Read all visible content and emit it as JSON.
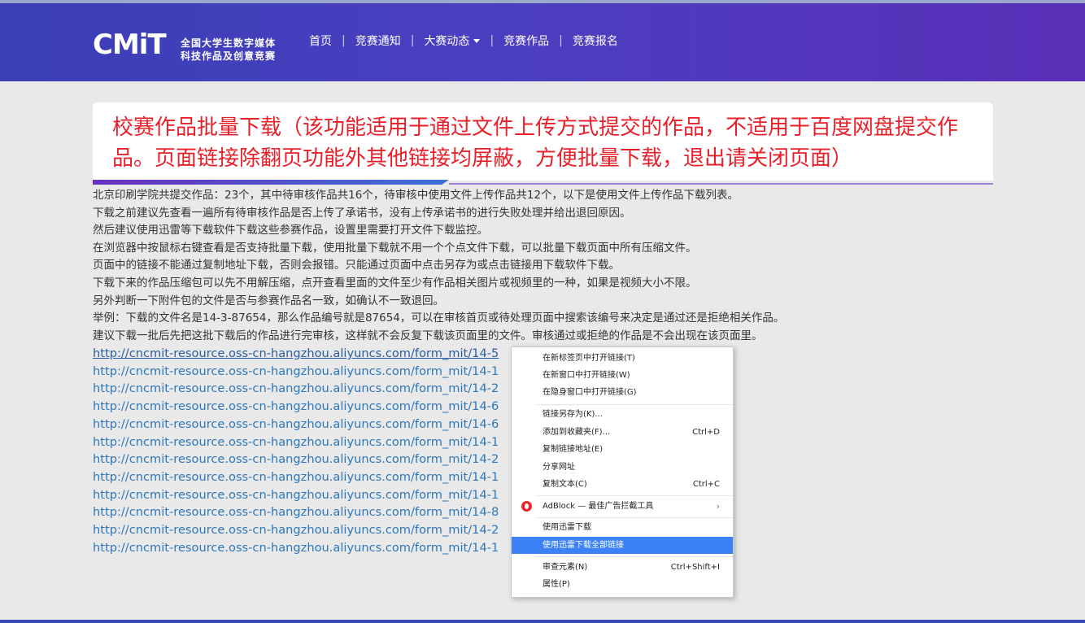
{
  "header": {
    "logo": {
      "mark": "CMiT",
      "line1": "全国大学生数字媒体",
      "line2": "科技作品及创意竞赛"
    },
    "nav": [
      {
        "label": "首页"
      },
      {
        "label": "竞赛通知"
      },
      {
        "label": "大赛动态",
        "has_dropdown": true
      },
      {
        "label": "竞赛作品"
      },
      {
        "label": "竞赛报名"
      }
    ],
    "nav_separator": "|"
  },
  "page": {
    "title": "校赛作品批量下载（该功能适用于通过文件上传方式提交的作品，不适用于百度网盘提交作品。页面链接除翻页功能外其他链接均屏蔽，方便批量下载，退出请关闭页面）",
    "info_lines": [
      "北京印刷学院共提交作品：23个，其中待审核作品共16个，待审核中使用文件上传作品共12个，以下是使用文件上传作品下载列表。",
      "下载之前建议先查看一遍所有待审核作品是否上传了承诺书，没有上传承诺书的进行失败处理并给出退回原因。",
      "然后建议使用迅雷等下载软件下载这些参赛作品，设置里需要打开文件下载监控。",
      "在浏览器中按鼠标右键查看是否支持批量下载，使用批量下载就不用一个个点文件下载，可以批量下载页面中所有压缩文件。",
      "页面中的链接不能通过复制地址下载，否则会报错。只能通过页面中点击另存为或点击链接用下载软件下载。",
      "下载下来的作品压缩包可以先不用解压缩，点开查看里面的文件至少有作品相关图片或视频里的一种，如果是视频大小不限。",
      "另外判断一下附件包的文件是否与参赛作品名一致，如确认不一致退回。",
      "举例：下载的文件名是14-3-87654，那么作品编号就是87654，可以在审核首页或待处理页面中搜索该编号来决定是通过还是拒绝相关作品。",
      "建议下载一批后先把这批下载后的作品进行完审核，这样就不会反复下载该页面里的文件。审核通过或拒绝的作品是不会出现在该页面里。"
    ],
    "links": [
      "http://cncmit-resource.oss-cn-hangzhou.aliyuncs.com/form_mit/14-5",
      "http://cncmit-resource.oss-cn-hangzhou.aliyuncs.com/form_mit/14-1",
      "http://cncmit-resource.oss-cn-hangzhou.aliyuncs.com/form_mit/14-2",
      "http://cncmit-resource.oss-cn-hangzhou.aliyuncs.com/form_mit/14-6",
      "http://cncmit-resource.oss-cn-hangzhou.aliyuncs.com/form_mit/14-6",
      "http://cncmit-resource.oss-cn-hangzhou.aliyuncs.com/form_mit/14-1",
      "http://cncmit-resource.oss-cn-hangzhou.aliyuncs.com/form_mit/14-2",
      "http://cncmit-resource.oss-cn-hangzhou.aliyuncs.com/form_mit/14-1",
      "http://cncmit-resource.oss-cn-hangzhou.aliyuncs.com/form_mit/14-1",
      "http://cncmit-resource.oss-cn-hangzhou.aliyuncs.com/form_mit/14-8",
      "http://cncmit-resource.oss-cn-hangzhou.aliyuncs.com/form_mit/14-2",
      "http://cncmit-resource.oss-cn-hangzhou.aliyuncs.com/form_mit/14-1"
    ]
  },
  "context_menu": {
    "items": [
      {
        "label": "在新标签页中打开链接(T)",
        "shortcut": ""
      },
      {
        "label": "在新窗口中打开链接(W)",
        "shortcut": ""
      },
      {
        "label": "在隐身窗口中打开链接(G)",
        "shortcut": ""
      },
      {
        "label": "链接另存为(K)...",
        "shortcut": ""
      },
      {
        "label": "添加到收藏夹(F)...",
        "shortcut": "Ctrl+D"
      },
      {
        "label": "复制链接地址(E)",
        "shortcut": ""
      },
      {
        "label": "分享网址",
        "shortcut": ""
      },
      {
        "label": "复制文本(C)",
        "shortcut": "Ctrl+C"
      },
      {
        "label": "AdBlock — 最佳广告拦截工具",
        "shortcut": "",
        "icon": "adblock-icon",
        "submenu": true
      },
      {
        "label": "使用迅雷下载",
        "shortcut": ""
      },
      {
        "label": "使用迅雷下载全部链接",
        "shortcut": "",
        "highlighted": true
      },
      {
        "label": "审查元素(N)",
        "shortcut": "Ctrl+Shift+I"
      },
      {
        "label": "属性(P)",
        "shortcut": ""
      }
    ],
    "highlight_color": "#3c82f6"
  },
  "colors": {
    "title_red": "#e8202a",
    "link_blue": "#2e77b8",
    "header_start": "#3a3fb6",
    "header_end": "#5a2fb8"
  }
}
